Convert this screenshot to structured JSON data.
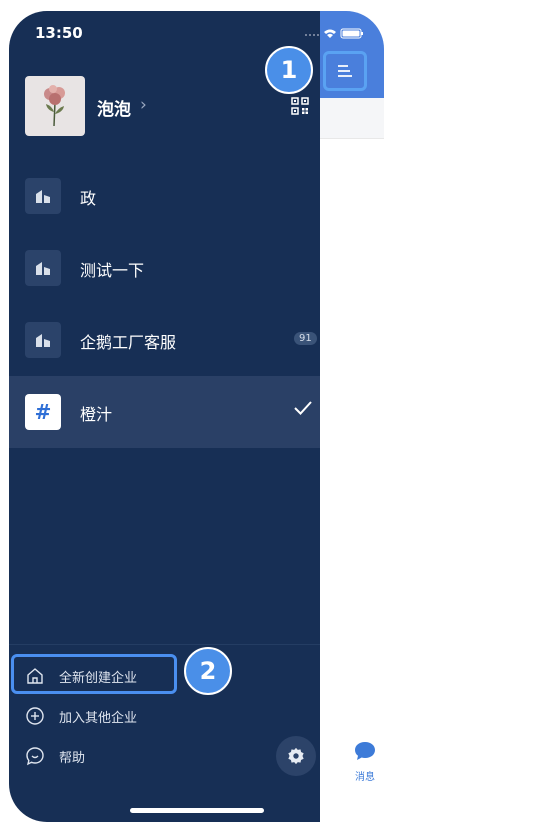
{
  "status": {
    "time": "13:50"
  },
  "user": {
    "name": "泡泡",
    "chevron": "›"
  },
  "orgs": [
    {
      "label": "政",
      "icon": "building-icon"
    },
    {
      "label": "测试一下",
      "icon": "building-icon"
    },
    {
      "label": "企鹅工厂客服",
      "icon": "building-icon",
      "count": "91"
    },
    {
      "label": "橙汁",
      "icon": "hash-icon",
      "symbol": "#",
      "selected": true
    }
  ],
  "bottom": {
    "create_label": "全新创建企业",
    "join_label": "加入其他企业",
    "help_label": "帮助"
  },
  "tabbar": {
    "messages_label": "消息"
  },
  "annotations": {
    "step1": "1",
    "step2": "2"
  },
  "colors": {
    "drawer_bg": "#172f55",
    "accent": "#4a8fe8",
    "header_blue": "#4a7fdc"
  }
}
